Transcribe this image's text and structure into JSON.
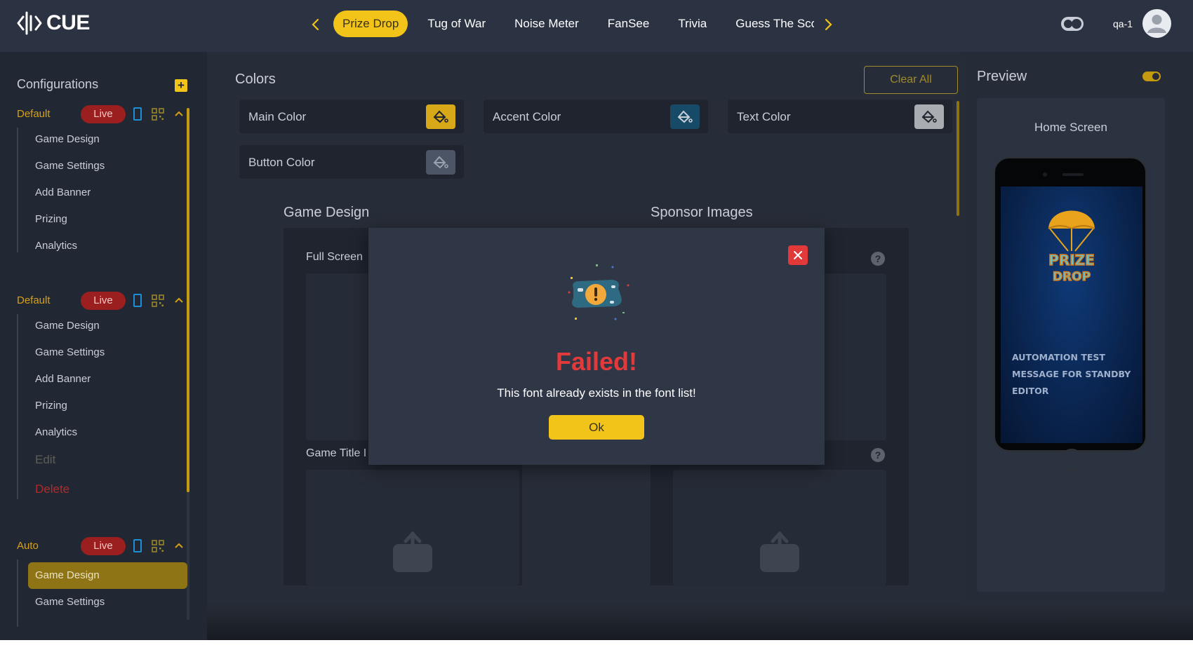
{
  "app": {
    "logo_text": "CUE"
  },
  "header": {
    "tabs": [
      {
        "label": "Prize Drop",
        "active": true
      },
      {
        "label": "Tug of War"
      },
      {
        "label": "Noise Meter"
      },
      {
        "label": "FanSee"
      },
      {
        "label": "Trivia"
      },
      {
        "label": "Guess The Sco"
      }
    ],
    "username": "qa-1"
  },
  "sidebar": {
    "title": "Configurations",
    "configs": [
      {
        "name": "Default",
        "status": "Live",
        "items": [
          "Game Design",
          "Game Settings",
          "Add Banner",
          "Prizing",
          "Analytics"
        ]
      },
      {
        "name": "Default",
        "status": "Live",
        "items": [
          "Game Design",
          "Game Settings",
          "Add Banner",
          "Prizing",
          "Analytics"
        ],
        "edit_label": "Edit",
        "delete_label": "Delete"
      },
      {
        "name": "Auto",
        "status": "Live",
        "items": [
          "Game Design",
          "Game Settings"
        ],
        "active_item": "Game Design"
      }
    ]
  },
  "main": {
    "colors_title": "Colors",
    "clear_all_label": "Clear All",
    "colors": [
      {
        "label": "Main Color",
        "swatch": "#d7a817"
      },
      {
        "label": "Accent Color",
        "swatch": "#164a66"
      },
      {
        "label": "Text Color",
        "swatch": "#a9acb1"
      },
      {
        "label": "Button Color",
        "swatch": "#4b5565"
      }
    ],
    "game_design_title": "Game Design",
    "sponsor_images_title": "Sponsor Images",
    "full_screen_label": "Full Screen",
    "game_title_label": "Game Title I"
  },
  "preview": {
    "title": "Preview",
    "screen_label": "Home Screen",
    "phone_message": "AUTOMATION TEST MESSAGE FOR STANDBY EDITOR"
  },
  "modal": {
    "title": "Failed!",
    "message": "This font already exists in the font list!",
    "ok_label": "Ok"
  },
  "colors": {
    "accent": "#f2c318",
    "live": "#9c1f1f",
    "error": "#e23a3a"
  }
}
